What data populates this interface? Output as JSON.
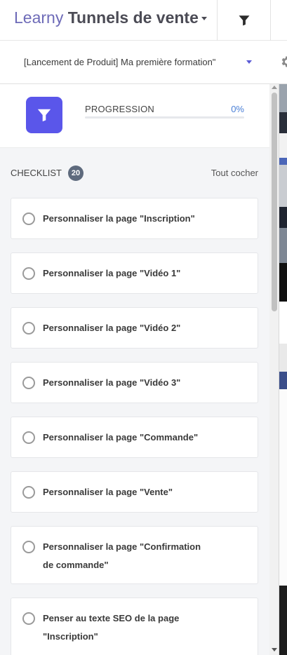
{
  "header": {
    "brand_prefix": "Learny",
    "brand_title": "Tunnels de vente",
    "filter_icon": "filter-icon"
  },
  "subbar": {
    "selected_funnel": "[Lancement de Produit] Ma première formation\"",
    "settings_icon": "gear-icon"
  },
  "progress": {
    "label": "PROGRESSION",
    "percent_text": "0%",
    "value": 0,
    "icon": "funnel-icon",
    "accent": "#5a56ea",
    "bar_color": "#4a7fd6"
  },
  "checklist": {
    "title": "CHECKLIST",
    "count": "20",
    "check_all": "Tout cocher",
    "items": [
      {
        "text": "Personnaliser la page \"Inscription\""
      },
      {
        "text": "Personnaliser la page \"Vidéo 1\""
      },
      {
        "text": "Personnaliser la page \"Vidéo 2\""
      },
      {
        "text": "Personnaliser la page \"Vidéo 3\""
      },
      {
        "text": "Personnaliser la page \"Commande\""
      },
      {
        "text": "Personnaliser la page \"Vente\""
      },
      {
        "line1": "Personnaliser la page \"Confirmation",
        "line2": "de commande\""
      },
      {
        "line1": "Penser au texte SEO de la page",
        "line2": "\"Inscription\""
      }
    ]
  }
}
